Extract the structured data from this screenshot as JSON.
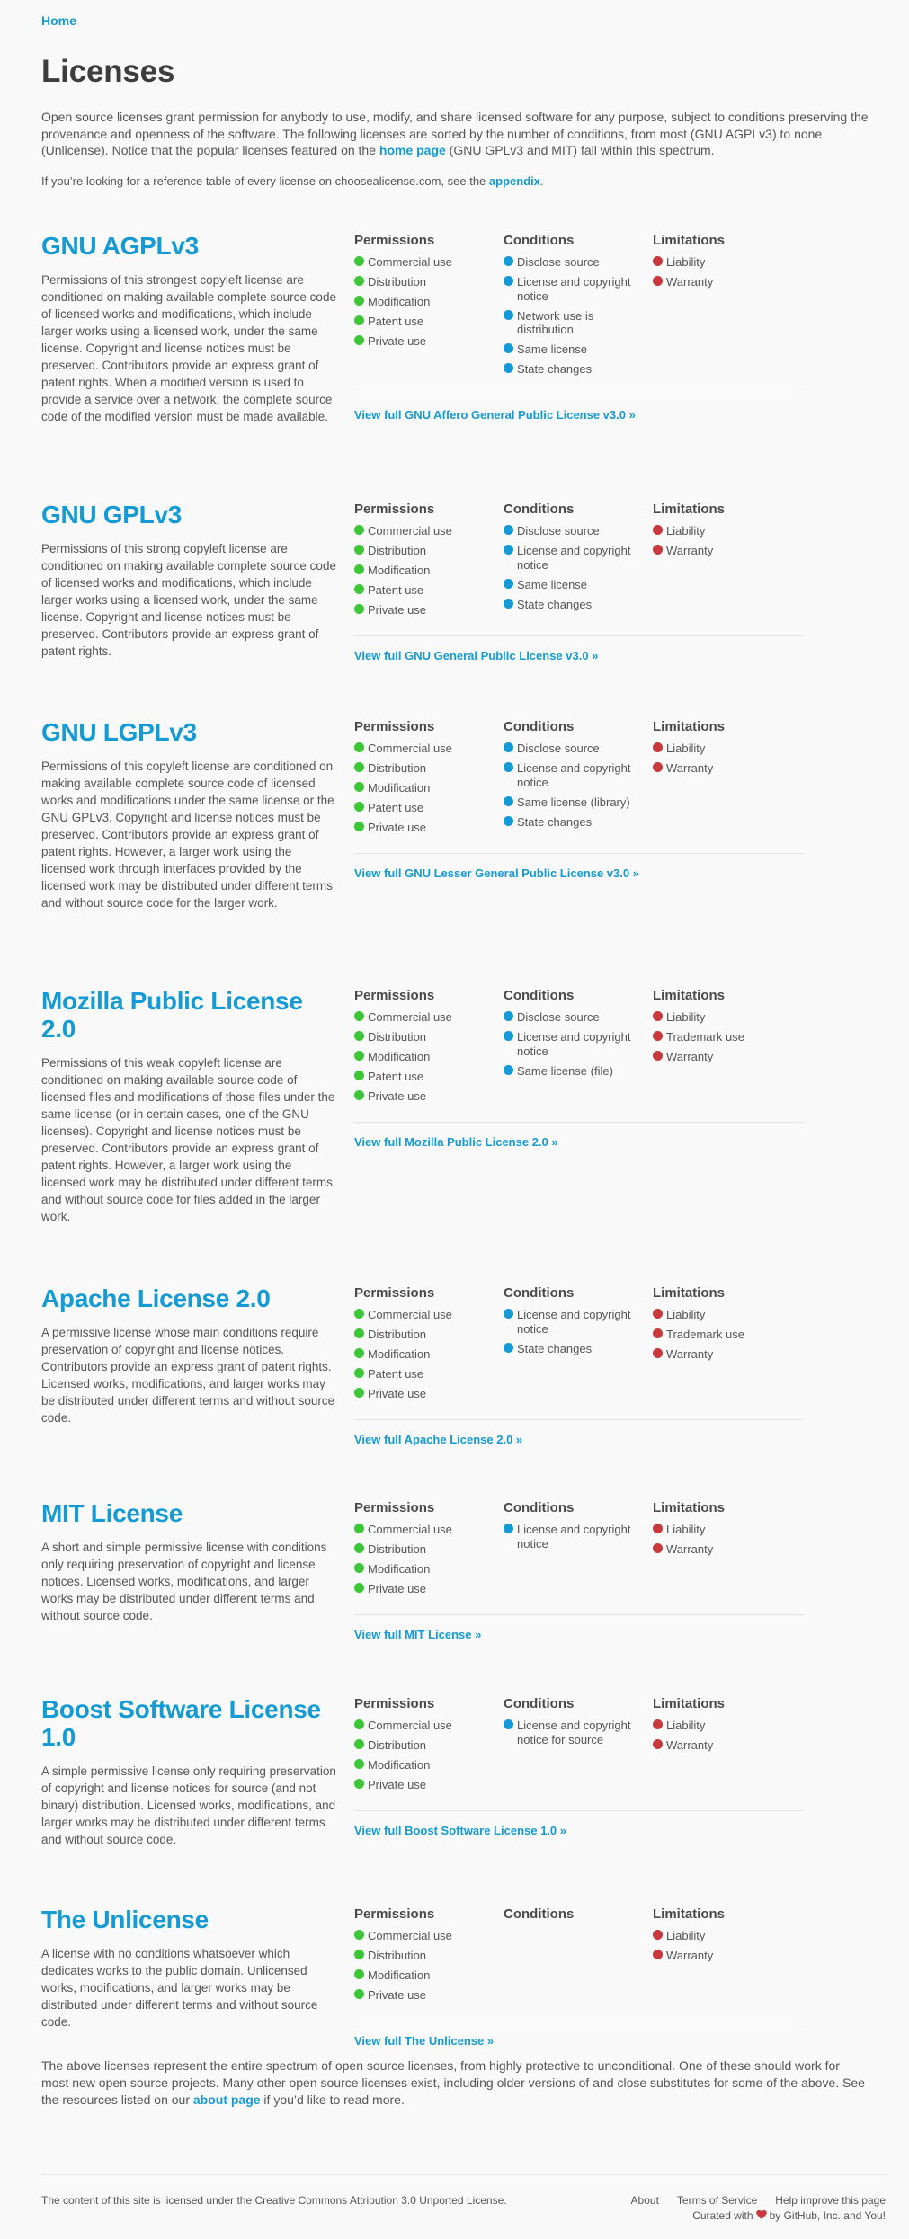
{
  "nav": {
    "home": "Home"
  },
  "page": {
    "title": "Licenses",
    "intro_a": "Open source licenses grant permission for anybody to use, modify, and share licensed software for any purpose, subject to conditions preserving the provenance and openness of the software. The following licenses are sorted by the number of conditions, from most (GNU AGPLv3) to none (Unlicense). Notice that the popular licenses featured on the ",
    "intro_link": "home page",
    "intro_b": " (GNU GPLv3 and MIT) fall within this spectrum.",
    "ref_a": "If you’re looking for a reference table of every license on choosealicense.com, see the ",
    "ref_link": "appendix",
    "ref_b": "."
  },
  "headers": {
    "permissions": "Permissions",
    "conditions": "Conditions",
    "limitations": "Limitations"
  },
  "licenses": [
    {
      "name": "GNU AGPLv3",
      "desc": "Permissions of this strongest copyleft license are conditioned on making available complete source code of licensed works and modifications, which include larger works using a licensed work, under the same license. Copyright and license notices must be preserved. Contributors provide an express grant of patent rights. When a modified version is used to provide a service over a network, the complete source code of the modified version must be made available.",
      "permissions": [
        "Commercial use",
        "Distribution",
        "Modification",
        "Patent use",
        "Private use"
      ],
      "conditions": [
        "Disclose source",
        "License and copyright notice",
        "Network use is distribution",
        "Same license",
        "State changes"
      ],
      "limitations": [
        "Liability",
        "Warranty"
      ],
      "link": "View full GNU Affero General Public License v3.0 »"
    },
    {
      "name": "GNU GPLv3",
      "desc": "Permissions of this strong copyleft license are conditioned on making available complete source code of licensed works and modifications, which include larger works using a licensed work, under the same license. Copyright and license notices must be preserved. Contributors provide an express grant of patent rights.",
      "permissions": [
        "Commercial use",
        "Distribution",
        "Modification",
        "Patent use",
        "Private use"
      ],
      "conditions": [
        "Disclose source",
        "License and copyright notice",
        "Same license",
        "State changes"
      ],
      "limitations": [
        "Liability",
        "Warranty"
      ],
      "link": "View full GNU General Public License v3.0 »"
    },
    {
      "name": "GNU LGPLv3",
      "desc": "Permissions of this copyleft license are conditioned on making available complete source code of licensed works and modifications under the same license or the GNU GPLv3. Copyright and license notices must be preserved. Contributors provide an express grant of patent rights. However, a larger work using the licensed work through interfaces provided by the licensed work may be distributed under different terms and without source code for the larger work.",
      "permissions": [
        "Commercial use",
        "Distribution",
        "Modification",
        "Patent use",
        "Private use"
      ],
      "conditions": [
        "Disclose source",
        "License and copyright notice",
        "Same license (library)",
        "State changes"
      ],
      "limitations": [
        "Liability",
        "Warranty"
      ],
      "link": "View full GNU Lesser General Public License v3.0 »"
    },
    {
      "name": "Mozilla Public License 2.0",
      "desc": "Permissions of this weak copyleft license are conditioned on making available source code of licensed files and modifications of those files under the same license (or in certain cases, one of the GNU licenses). Copyright and license notices must be preserved. Contributors provide an express grant of patent rights. However, a larger work using the licensed work may be distributed under different terms and without source code for files added in the larger work.",
      "permissions": [
        "Commercial use",
        "Distribution",
        "Modification",
        "Patent use",
        "Private use"
      ],
      "conditions": [
        "Disclose source",
        "License and copyright notice",
        "Same license (file)"
      ],
      "limitations": [
        "Liability",
        "Trademark use",
        "Warranty"
      ],
      "link": "View full Mozilla Public License 2.0 »"
    },
    {
      "name": "Apache License 2.0",
      "desc": "A permissive license whose main conditions require preservation of copyright and license notices. Contributors provide an express grant of patent rights. Licensed works, modifications, and larger works may be distributed under different terms and without source code.",
      "permissions": [
        "Commercial use",
        "Distribution",
        "Modification",
        "Patent use",
        "Private use"
      ],
      "conditions": [
        "License and copyright notice",
        "State changes"
      ],
      "limitations": [
        "Liability",
        "Trademark use",
        "Warranty"
      ],
      "link": "View full Apache License 2.0 »"
    },
    {
      "name": "MIT License",
      "desc": "A short and simple permissive license with conditions only requiring preservation of copyright and license notices. Licensed works, modifications, and larger works may be distributed under different terms and without source code.",
      "permissions": [
        "Commercial use",
        "Distribution",
        "Modification",
        "Private use"
      ],
      "conditions": [
        "License and copyright notice"
      ],
      "limitations": [
        "Liability",
        "Warranty"
      ],
      "link": "View full MIT License »"
    },
    {
      "name": "Boost Software License 1.0",
      "desc": "A simple permissive license only requiring preservation of copyright and license notices for source (and not binary) distribution. Licensed works, modifications, and larger works may be distributed under different terms and without source code.",
      "permissions": [
        "Commercial use",
        "Distribution",
        "Modification",
        "Private use"
      ],
      "conditions": [
        "License and copyright notice for source"
      ],
      "limitations": [
        "Liability",
        "Warranty"
      ],
      "link": "View full Boost Software License 1.0 »"
    },
    {
      "name": "The Unlicense",
      "desc": "A license with no conditions whatsoever which dedicates works to the public domain. Unlicensed works, modifications, and larger works may be distributed under different terms and without source code.",
      "permissions": [
        "Commercial use",
        "Distribution",
        "Modification",
        "Private use"
      ],
      "conditions": [],
      "limitations": [
        "Liability",
        "Warranty"
      ],
      "link": "View full The Unlicense »"
    }
  ],
  "outro": {
    "text_a": "The above licenses represent the entire spectrum of open source licenses, from highly protective to unconditional. One of these should work for most new open source projects. Many other open source licenses exist, including older versions of and close substitutes for some of the above. See the resources listed on our ",
    "link": "about page",
    "text_b": " if you’d like to read more."
  },
  "footer": {
    "license_a": "The content of this site is licensed under the ",
    "license_link": "Creative Commons Attribution 3.0 Unported License",
    "license_b": ".",
    "nav": [
      "About",
      "Terms of Service",
      "Help improve this page"
    ],
    "credit_a": "Curated with",
    "credit_b": "by GitHub, Inc. and You!"
  },
  "colors": {
    "accent": "#149ad4",
    "permission": "#3dc637",
    "condition": "#149ad4",
    "limitation": "#c8383c"
  },
  "icons": {
    "permission": "green-dot-icon",
    "condition": "blue-dot-icon",
    "limitation": "red-dot-icon",
    "heart": "heart-icon"
  }
}
